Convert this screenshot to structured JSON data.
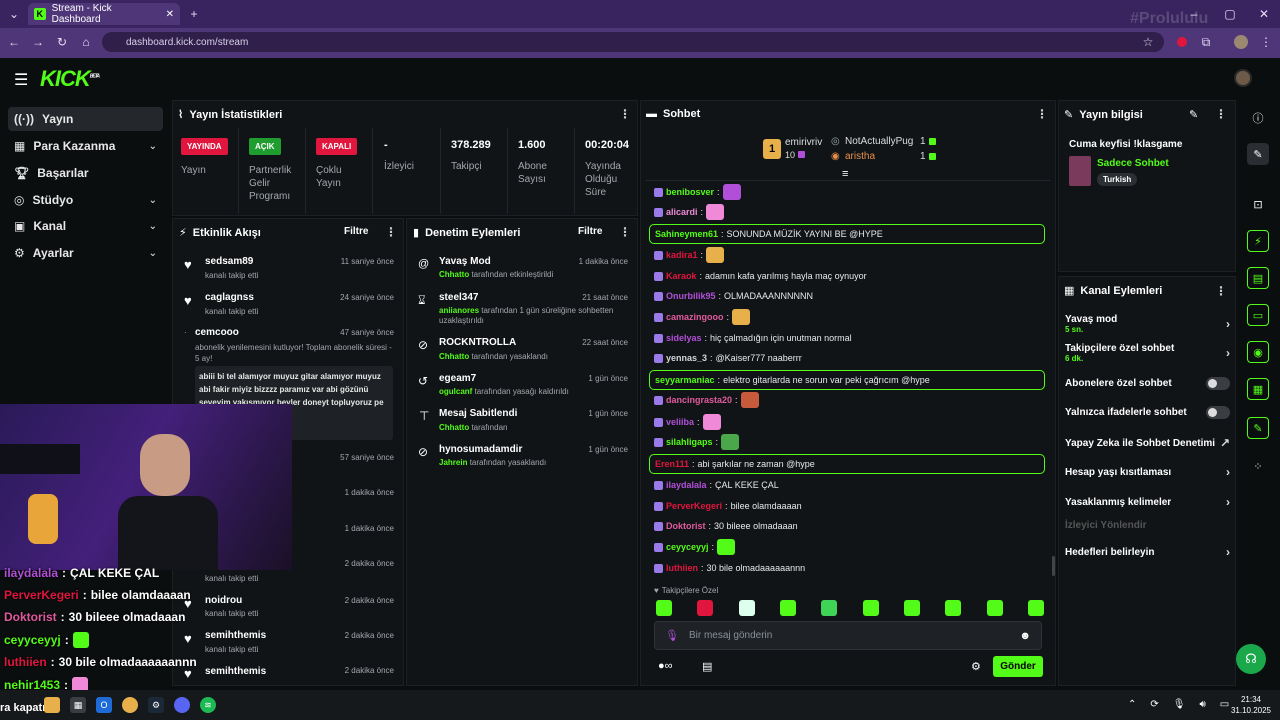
{
  "browser": {
    "tab_title": "Stream - Kick Dashboard",
    "url": "dashboard.kick.com/stream",
    "watermark": "#Prolululu"
  },
  "header": {
    "logo": "KICK",
    "logo_sup": "BETA"
  },
  "sidebar": {
    "items": [
      {
        "label": "Yayın",
        "icon": "broadcast-icon",
        "active": true
      },
      {
        "label": "Para Kazanma",
        "icon": "money-icon",
        "chevron": true
      },
      {
        "label": "Başarılar",
        "icon": "trophy-icon"
      },
      {
        "label": "Stüdyo",
        "icon": "studio-icon",
        "chevron": true
      },
      {
        "label": "Kanal",
        "icon": "channel-icon",
        "chevron": true
      },
      {
        "label": "Ayarlar",
        "icon": "gear-icon",
        "chevron": true
      }
    ]
  },
  "stats": {
    "title": "Yayın İstatistikleri",
    "cols": [
      {
        "value": "YAYINDA",
        "label": "Yayın",
        "badge_color": "#e0163e"
      },
      {
        "value": "AÇIK",
        "label": "Partnerlik Gelir Programı",
        "badge_color": "#1f9d2e"
      },
      {
        "value": "KAPALI",
        "label": "Çoklu Yayın",
        "badge_color": "#e0163e"
      },
      {
        "value": "-",
        "label": "İzleyici"
      },
      {
        "value": "378.289",
        "label": "Takipçi"
      },
      {
        "value": "1.600",
        "label": "Abone Sayısı"
      },
      {
        "value": "00:20:04",
        "label": "Yayında Olduğu Süre"
      }
    ]
  },
  "activity": {
    "title": "Etkinlik Akışı",
    "filter": "Filtre",
    "items": [
      {
        "name": "sedsam89",
        "sub": "kanalı takip etti",
        "time": "11 saniye önce"
      },
      {
        "name": "caglagnss",
        "sub": "kanalı takip etti",
        "time": "24 saniye önce"
      },
      {
        "name": "cemcooo",
        "sub": "abonelik yenilemesini kutluyor! Toplam abonelik süresi - 5 ay!",
        "time": "47 saniye önce",
        "message": "abiii bi tel alamıyor muyuz gitar alamıyor muyuz abi fakir miyiz bizzzz paramız var abi gözünü seveyim yakışmıyor beyler doneyt topluyoruz pe bozuk gitarıda"
      },
      {
        "name": "",
        "sub": "",
        "time": "57 saniye önce"
      },
      {
        "name": "",
        "sub": "",
        "time": "1 dakika önce"
      },
      {
        "name": "",
        "sub": "",
        "time": "1 dakika önce"
      },
      {
        "name": "",
        "sub": "kanalı takip etti",
        "time": "2 dakika önce"
      },
      {
        "name": "noidrou",
        "sub": "kanalı takip etti",
        "time": "2 dakika önce"
      },
      {
        "name": "semihthemis",
        "sub": "kanalı takip etti",
        "time": "2 dakika önce"
      },
      {
        "name": "semihthemis",
        "sub": "",
        "time": "2 dakika önce"
      }
    ]
  },
  "moderation": {
    "title": "Denetim Eylemleri",
    "filter": "Filtre",
    "items": [
      {
        "title": "Yavaş Mod",
        "actor": "Chhatto",
        "desc": "tarafından etkinleştirildi",
        "time": "1 dakika önce",
        "icon": "snail-icon"
      },
      {
        "title": "steel347",
        "actor": "aniianores",
        "desc": "tarafından 1 gün süreliğine sohbetten uzaklaştırıldı",
        "time": "21 saat önce",
        "icon": "hourglass-icon"
      },
      {
        "title": "ROCKNTROLLA",
        "actor": "Chhatto",
        "desc": "tarafından yasaklandı",
        "time": "22 saat önce",
        "icon": "ban-icon"
      },
      {
        "title": "egeam7",
        "actor": "ogulcanf",
        "desc": "tarafından yasağı kaldırıldı",
        "time": "1 gün önce",
        "icon": "undo-icon"
      },
      {
        "title": "Mesaj Sabitlendi",
        "actor": "Chhatto",
        "desc": "tarafından",
        "time": "1 gün önce",
        "icon": "pin-icon"
      },
      {
        "title": "hynosumadamdir",
        "actor": "Jahrein",
        "desc": "tarafından yasaklandı",
        "time": "1 gün önce",
        "icon": "ban-icon"
      }
    ]
  },
  "chat": {
    "title": "Sohbet",
    "top_gifter": {
      "rank": "1",
      "name": "emirivriv",
      "count": "10"
    },
    "gifters": [
      {
        "name": "NotActuallyPug",
        "count": "1"
      },
      {
        "name": "aristha",
        "count": "1"
      }
    ],
    "messages": [
      {
        "user": "benibosver",
        "color": "#53fc18",
        "text": "",
        "emote": "#b14fd8"
      },
      {
        "user": "alicardi",
        "color": "#f08ad8",
        "text": "",
        "emote": "#f08ad8"
      },
      {
        "user": "Sahineymen61",
        "color": "#53fc18",
        "text": "SONUNDA MÜZİK YAYINI BE @HYPE",
        "highlight": true
      },
      {
        "user": "kadira1",
        "color": "#e0163e",
        "text": "",
        "emote": "#e8b04a"
      },
      {
        "user": "Karaok",
        "color": "#e0163e",
        "text": "adamın kafa yarılmış hayla maç oynuyor"
      },
      {
        "user": "Onurbilik95",
        "color": "#b14fd8",
        "text": "OLMADAAANNNNNN"
      },
      {
        "user": "camazingooo",
        "color": "#e05a9c",
        "text": "",
        "emote": "#e8b04a"
      },
      {
        "user": "sidelyas",
        "color": "#b14fd8",
        "text": "hiç çalmadığın için unutman normal"
      },
      {
        "user": "yennas_3",
        "color": "#d5d5d5",
        "text": "@Kaiser777 naaberrr"
      },
      {
        "user": "seyyarmaniac",
        "color": "#53fc18",
        "text": "elektro gitarlarda ne sorun var peki çağrıcım @hype",
        "highlight": true
      },
      {
        "user": "dancingrasta20",
        "color": "#e05a9c",
        "text": "",
        "emote": "#c85a3c"
      },
      {
        "user": "veliiba",
        "color": "#b14fd8",
        "text": "",
        "emote": "#f08ad8"
      },
      {
        "user": "silahligaps",
        "color": "#53fc18",
        "text": "",
        "emote": "#4aa84a"
      },
      {
        "user": "Eren111",
        "color": "#e0163e",
        "text": "abi şarkılar ne zaman @hype",
        "highlight": true
      },
      {
        "user": "ilaydalala",
        "color": "#b14fd8",
        "text": "ÇAL KEKE ÇAL"
      },
      {
        "user": "PerverKegeri",
        "color": "#e0163e",
        "text": "bilee olamdaaaan"
      },
      {
        "user": "Doktorist",
        "color": "#e05a9c",
        "text": "30 bileee olmadaaan"
      },
      {
        "user": "ceyyceyyj",
        "color": "#53fc18",
        "text": "",
        "emote": "#53fc18"
      },
      {
        "user": "luthiien",
        "color": "#e0163e",
        "text": "30 bile olmadaaaaaannn"
      }
    ],
    "followers_only": "Takipçilere Özel",
    "input_placeholder": "Bir mesaj gönderin",
    "send": "Gönder"
  },
  "stream_info": {
    "title": "Yayın bilgisi",
    "stream_title": "Cuma keyfisi !klasgame",
    "category": "Sadece Sohbet",
    "tag": "Turkish"
  },
  "channel_actions": {
    "title": "Kanal Eylemleri",
    "items": [
      {
        "label": "Yavaş mod",
        "sub": "5 sn.",
        "kind": "chevron"
      },
      {
        "label": "Takipçilere özel sohbet",
        "sub": "6 dk.",
        "kind": "chevron"
      },
      {
        "label": "Abonelere özel sohbet",
        "kind": "toggle"
      },
      {
        "label": "Yalnızca ifadelerle sohbet",
        "kind": "toggle"
      },
      {
        "label": "Yapay Zeka ile Sohbet Denetimi",
        "kind": "external"
      },
      {
        "label": "Hesap yaşı kısıtlaması",
        "kind": "chevron"
      },
      {
        "label": "Yasaklanmış kelimeler",
        "kind": "chevron"
      },
      {
        "label": "İzleyici Yönlendir",
        "kind": "disabled"
      },
      {
        "label": "Hedefleri belirleyin",
        "kind": "chevron"
      }
    ]
  },
  "overlay_chat": [
    {
      "user": "ilaydalala",
      "color": "#b14fd8",
      "text": "ÇAL KEKE ÇAL"
    },
    {
      "user": "PerverKegeri",
      "color": "#e0163e",
      "text": "bilee olamdaaaan"
    },
    {
      "user": "Doktorist",
      "color": "#e05a9c",
      "text": "30 bileee olmadaaan"
    },
    {
      "user": "ceyyceyyj",
      "color": "#53fc18",
      "text": ""
    },
    {
      "user": "luthiien",
      "color": "#e0163e",
      "text": "30 bile olmadaaaaaannn"
    },
    {
      "user": "nehir1453",
      "color": "#53fc18",
      "text": ""
    }
  ],
  "taskbar": {
    "left_text": "ra kapatır..",
    "time": "21:34",
    "date": "31.10.2025"
  }
}
